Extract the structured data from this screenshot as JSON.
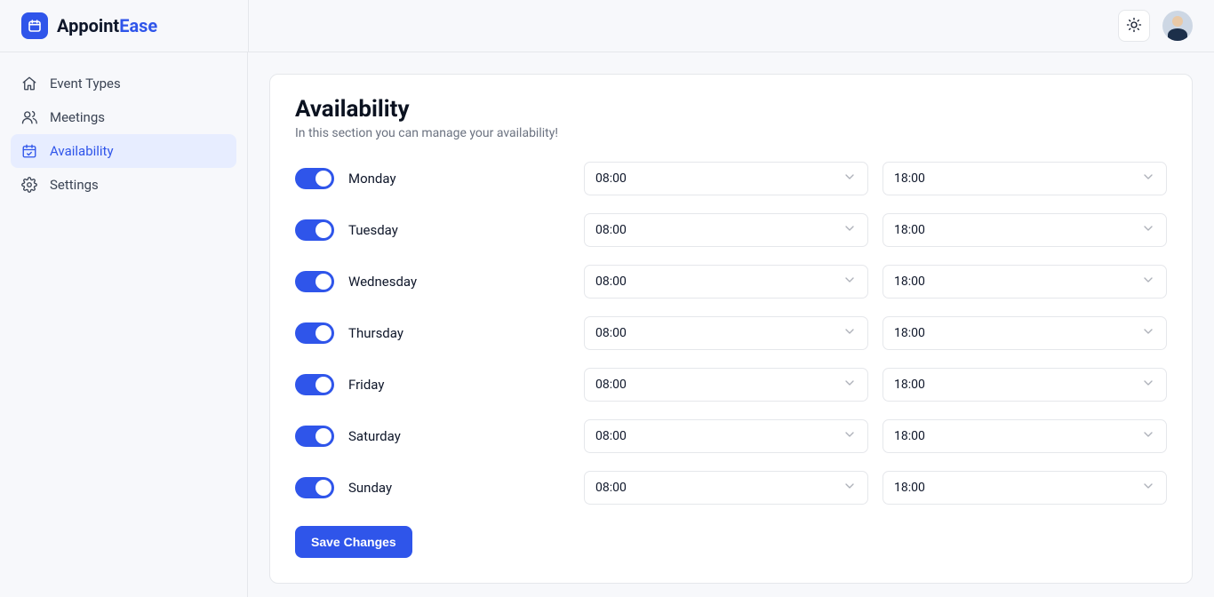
{
  "brand": {
    "name_a": "Appoint",
    "name_b": "Ease"
  },
  "sidebar": {
    "items": [
      {
        "label": "Event Types"
      },
      {
        "label": "Meetings"
      },
      {
        "label": "Availability"
      },
      {
        "label": "Settings"
      }
    ]
  },
  "page": {
    "title": "Availability",
    "subtitle": "In this section you can manage your availability!"
  },
  "availability": [
    {
      "day": "Monday",
      "enabled": true,
      "from": "08:00",
      "till": "18:00"
    },
    {
      "day": "Tuesday",
      "enabled": true,
      "from": "08:00",
      "till": "18:00"
    },
    {
      "day": "Wednesday",
      "enabled": true,
      "from": "08:00",
      "till": "18:00"
    },
    {
      "day": "Thursday",
      "enabled": true,
      "from": "08:00",
      "till": "18:00"
    },
    {
      "day": "Friday",
      "enabled": true,
      "from": "08:00",
      "till": "18:00"
    },
    {
      "day": "Saturday",
      "enabled": true,
      "from": "08:00",
      "till": "18:00"
    },
    {
      "day": "Sunday",
      "enabled": true,
      "from": "08:00",
      "till": "18:00"
    }
  ],
  "actions": {
    "save": "Save Changes"
  }
}
